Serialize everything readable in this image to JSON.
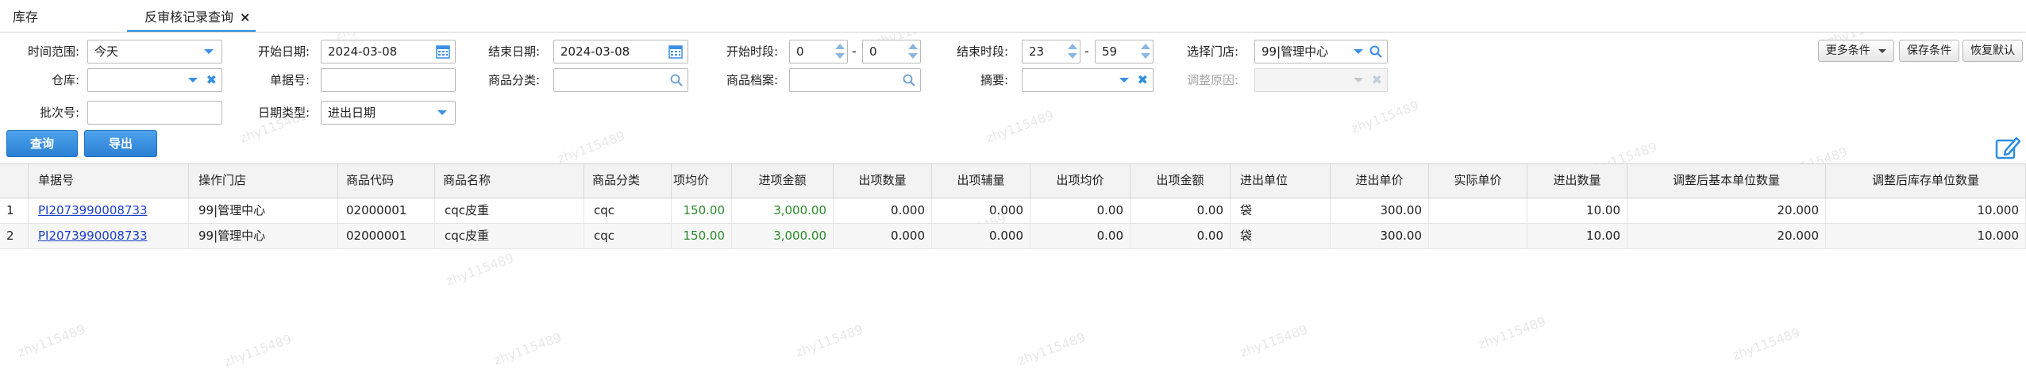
{
  "tabs": {
    "inventory": "库存",
    "active": "反审核记录查询",
    "close": "×"
  },
  "filters": {
    "time_range": {
      "label": "时间范围:",
      "value": "今天"
    },
    "start_date": {
      "label": "开始日期:",
      "value": "2024-03-08"
    },
    "end_date": {
      "label": "结束日期:",
      "value": "2024-03-08"
    },
    "start_time": {
      "label": "开始时段:",
      "hour": "0",
      "minute": "0"
    },
    "end_time": {
      "label": "结束时段:",
      "hour": "23",
      "minute": "59"
    },
    "store": {
      "label": "选择门店:",
      "value": "99|管理中心"
    },
    "warehouse": {
      "label": "仓库:",
      "value": ""
    },
    "doc_no": {
      "label": "单据号:",
      "value": ""
    },
    "category": {
      "label": "商品分类:",
      "value": ""
    },
    "archive": {
      "label": "商品档案:",
      "value": ""
    },
    "summary": {
      "label": "摘要:",
      "value": ""
    },
    "reason": {
      "label": "调整原因:",
      "value": ""
    },
    "batch_no": {
      "label": "批次号:",
      "value": ""
    },
    "date_type": {
      "label": "日期类型:",
      "value": "进出日期"
    },
    "dash": "-"
  },
  "buttons": {
    "more": "更多条件",
    "save": "保存条件",
    "reset": "恢复默认",
    "query": "查询",
    "export": "导出"
  },
  "table": {
    "headers": [
      "单据号",
      "操作门店",
      "商品代码",
      "商品名称",
      "商品分类",
      "项均价",
      "进项金额",
      "出项数量",
      "出项辅量",
      "出项均价",
      "出项金额",
      "进出单位",
      "进出单价",
      "实际单价",
      "进出数量",
      "调整后基本单位数量",
      "调整后库存单位数量"
    ],
    "rows": [
      {
        "idx": "1",
        "cells": [
          "PI2073990008733",
          "99|管理中心",
          "02000001",
          "cqc皮重",
          "cqc",
          "150.00",
          "3,000.00",
          "0.000",
          "0.000",
          "0.00",
          "0.00",
          "袋",
          "300.00",
          "",
          "10.00",
          "20.000",
          "10.000"
        ]
      },
      {
        "idx": "2",
        "cells": [
          "PI2073990008733",
          "99|管理中心",
          "02000001",
          "cqc皮重",
          "cqc",
          "150.00",
          "3,000.00",
          "0.000",
          "0.000",
          "0.00",
          "0.00",
          "袋",
          "300.00",
          "",
          "10.00",
          "20.000",
          "10.000"
        ]
      }
    ]
  },
  "watermark": "zhy115489",
  "colors": {
    "accent": "#2f8fe0",
    "link": "#1a3fc8",
    "green": "#2b8a2b"
  }
}
